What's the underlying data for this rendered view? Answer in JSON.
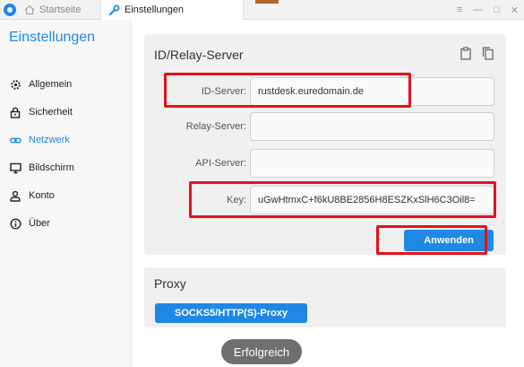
{
  "titlebar": {
    "tabs": [
      {
        "label": "Startseite",
        "icon": "home-icon",
        "active": false
      },
      {
        "label": "Einstellungen",
        "icon": "wrench-icon",
        "active": true
      }
    ],
    "controls": {
      "menu": "≡",
      "minimize": "—",
      "maximize": "□",
      "close": "✕"
    }
  },
  "sidebar": {
    "title": "Einstellungen",
    "items": [
      {
        "label": "Allgemein",
        "icon": "gear-icon",
        "active": false
      },
      {
        "label": "Sicherheit",
        "icon": "lock-icon",
        "active": false
      },
      {
        "label": "Netzwerk",
        "icon": "link-icon",
        "active": true
      },
      {
        "label": "Bildschirm",
        "icon": "monitor-icon",
        "active": false
      },
      {
        "label": "Konto",
        "icon": "user-icon",
        "active": false
      },
      {
        "label": "Über",
        "icon": "info-icon",
        "active": false
      }
    ]
  },
  "server_card": {
    "title": "ID/Relay-Server",
    "icons": [
      "clipboard-icon",
      "copy-icon"
    ],
    "fields": [
      {
        "label": "ID-Server:",
        "value": "rustdesk.euredomain.de"
      },
      {
        "label": "Relay-Server:",
        "value": ""
      },
      {
        "label": "API-Server:",
        "value": ""
      },
      {
        "label": "Key:",
        "value": "uGwHtmxC+f6kU8BE2856H8ESZKxSlH6C3Oil8="
      }
    ],
    "apply_label": "Anwenden"
  },
  "proxy_card": {
    "title": "Proxy",
    "button_label": "SOCKS5/HTTP(S)-Proxy"
  },
  "toast": {
    "text": "Erfolgreich"
  },
  "colors": {
    "accent": "#1e88e5",
    "highlight": "#e3121c",
    "card": "#f0f0f0"
  }
}
